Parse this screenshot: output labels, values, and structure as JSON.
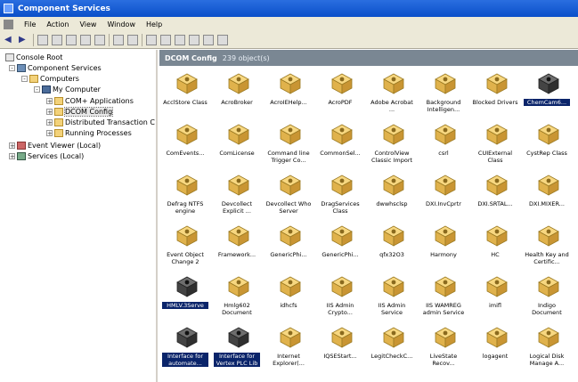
{
  "window": {
    "title": "Component Services"
  },
  "menu": [
    "File",
    "Action",
    "View",
    "Window",
    "Help"
  ],
  "tree": {
    "console_root": "Console Root",
    "component_services": "Component Services",
    "computers": "Computers",
    "my_computer": "My Computer",
    "complus": "COM+ Applications",
    "dcom_config": "DCOM Config",
    "distributed_tc": "Distributed Transaction C",
    "running_processes": "Running Processes",
    "event_viewer": "Event Viewer (Local)",
    "services": "Services (Local)"
  },
  "list": {
    "title": "DCOM Config",
    "count": "239 object(s)"
  },
  "items": [
    {
      "label": "AcclStore Class",
      "icon": "box"
    },
    {
      "label": "AcroBroker",
      "icon": "box"
    },
    {
      "label": "AcroIEHelp...",
      "icon": "box"
    },
    {
      "label": "AcroPDF",
      "icon": "box"
    },
    {
      "label": "Adobe Acrobat ...",
      "icon": "box"
    },
    {
      "label": "Background Intelligen...",
      "icon": "box"
    },
    {
      "label": "Blocked Drivers",
      "icon": "box"
    },
    {
      "label": "ChemCam6...",
      "icon": "dark",
      "selected": true
    },
    {
      "label": "ComEvents...",
      "icon": "box"
    },
    {
      "label": "ComLicense",
      "icon": "box"
    },
    {
      "label": "Command line Trigger Co...",
      "icon": "box"
    },
    {
      "label": "CommonSel...",
      "icon": "box"
    },
    {
      "label": "ControlView Classic Import",
      "icon": "box"
    },
    {
      "label": "csrl",
      "icon": "box"
    },
    {
      "label": "CUIExternal Class",
      "icon": "box"
    },
    {
      "label": "CystRep Class",
      "icon": "box"
    },
    {
      "label": "Defrag NTFS engine",
      "icon": "box"
    },
    {
      "label": "Devcollect Explicit ...",
      "icon": "box"
    },
    {
      "label": "Devcollect Who Server",
      "icon": "box"
    },
    {
      "label": "DragServices Class",
      "icon": "box"
    },
    {
      "label": "dwwhsclsp",
      "icon": "box"
    },
    {
      "label": "DXI.InvCprtr",
      "icon": "box"
    },
    {
      "label": "DXI.SRTAL...",
      "icon": "box"
    },
    {
      "label": "DXI.MIXER...",
      "icon": "box"
    },
    {
      "label": "Event Object Change 2",
      "icon": "box"
    },
    {
      "label": "Framework...",
      "icon": "box"
    },
    {
      "label": "GenericPhi...",
      "icon": "box"
    },
    {
      "label": "GenericPhi...",
      "icon": "box"
    },
    {
      "label": "qfx32O3",
      "icon": "box"
    },
    {
      "label": "Harmony",
      "icon": "box"
    },
    {
      "label": "HC",
      "icon": "box"
    },
    {
      "label": "Health Key and Certific...",
      "icon": "box"
    },
    {
      "label": "HMLV.3Serve",
      "icon": "dark",
      "selected": true
    },
    {
      "label": "Hmlg602 Document",
      "icon": "box"
    },
    {
      "label": "idhcfs",
      "icon": "box"
    },
    {
      "label": "IIS Admin Crypto...",
      "icon": "box"
    },
    {
      "label": "IIS Admin Service",
      "icon": "box"
    },
    {
      "label": "IIS WAMREG admin Service",
      "icon": "box"
    },
    {
      "label": "imifl",
      "icon": "box"
    },
    {
      "label": "Indigo Document",
      "icon": "box"
    },
    {
      "label": "Interface for automate...",
      "icon": "dark",
      "selected": true
    },
    {
      "label": "Interface for Vertex PLC Lib",
      "icon": "dark",
      "selected": true
    },
    {
      "label": "Internet Explorer(...",
      "icon": "box"
    },
    {
      "label": "IQSEStart...",
      "icon": "box"
    },
    {
      "label": "LegitCheckC...",
      "icon": "box"
    },
    {
      "label": "LiveState Recov...",
      "icon": "box"
    },
    {
      "label": "logagent",
      "icon": "box"
    },
    {
      "label": "Logical Disk Manage A...",
      "icon": "box"
    }
  ],
  "colors": {
    "title_bar": "#0a4fc9",
    "list_header": "#7a8793",
    "selection": "#0a246a",
    "folder": "#f3d27a"
  }
}
